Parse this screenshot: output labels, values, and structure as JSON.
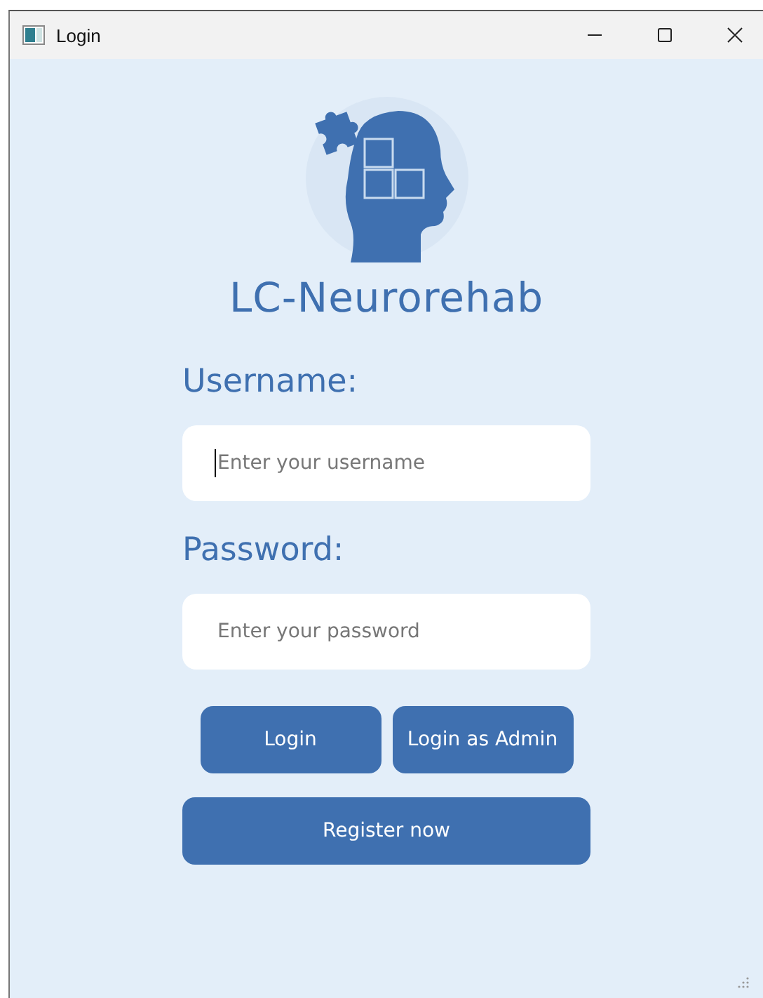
{
  "window": {
    "title": "Login"
  },
  "app_name": "LC-Neurorehab",
  "fields": [
    {
      "label": "Username:",
      "placeholder": "Enter your username",
      "focused": true
    },
    {
      "label": "Password:",
      "placeholder": "Enter your password",
      "focused": false
    }
  ],
  "buttons": [
    {
      "label": "Login",
      "kind": "small"
    },
    {
      "label": "Login as Admin",
      "kind": "small"
    },
    {
      "label": "Register now",
      "kind": "wide"
    }
  ]
}
